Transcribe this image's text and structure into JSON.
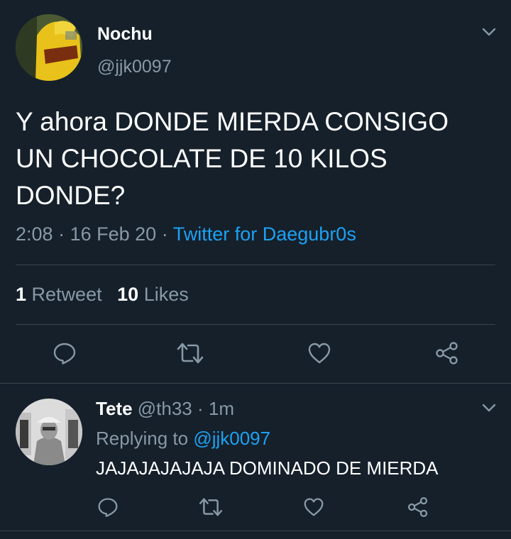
{
  "main_tweet": {
    "author_name": "Nochu",
    "author_handle": "@jjk0097",
    "text_lines": [
      "Y ahora DONDE MIERDA CONSIGO",
      "UN CHOCOLATE DE 10 KILOS",
      "DONDE?"
    ],
    "time": "2:08",
    "separator": "·",
    "date": "16 Feb 20",
    "source": "Twitter for Daegubr0s",
    "retweet_count": "1",
    "retweet_label": "Retweet",
    "like_count": "10",
    "like_label": "Likes"
  },
  "reply": {
    "author_name": "Tete",
    "author_handle": "@th33",
    "separator": "·",
    "time_ago": "1m",
    "replying_label": "Replying to",
    "replying_handle": "@jjk0097",
    "text": "JAJAJAJAJAJA DOMINADO DE MIERDA"
  },
  "colors": {
    "background": "#15202b",
    "text": "#ffffff",
    "muted": "#8899a6",
    "accent": "#1da1f2",
    "divider": "#38444d"
  },
  "icons": [
    "chevron-down-icon",
    "reply-icon",
    "retweet-icon",
    "like-icon",
    "share-icon"
  ]
}
